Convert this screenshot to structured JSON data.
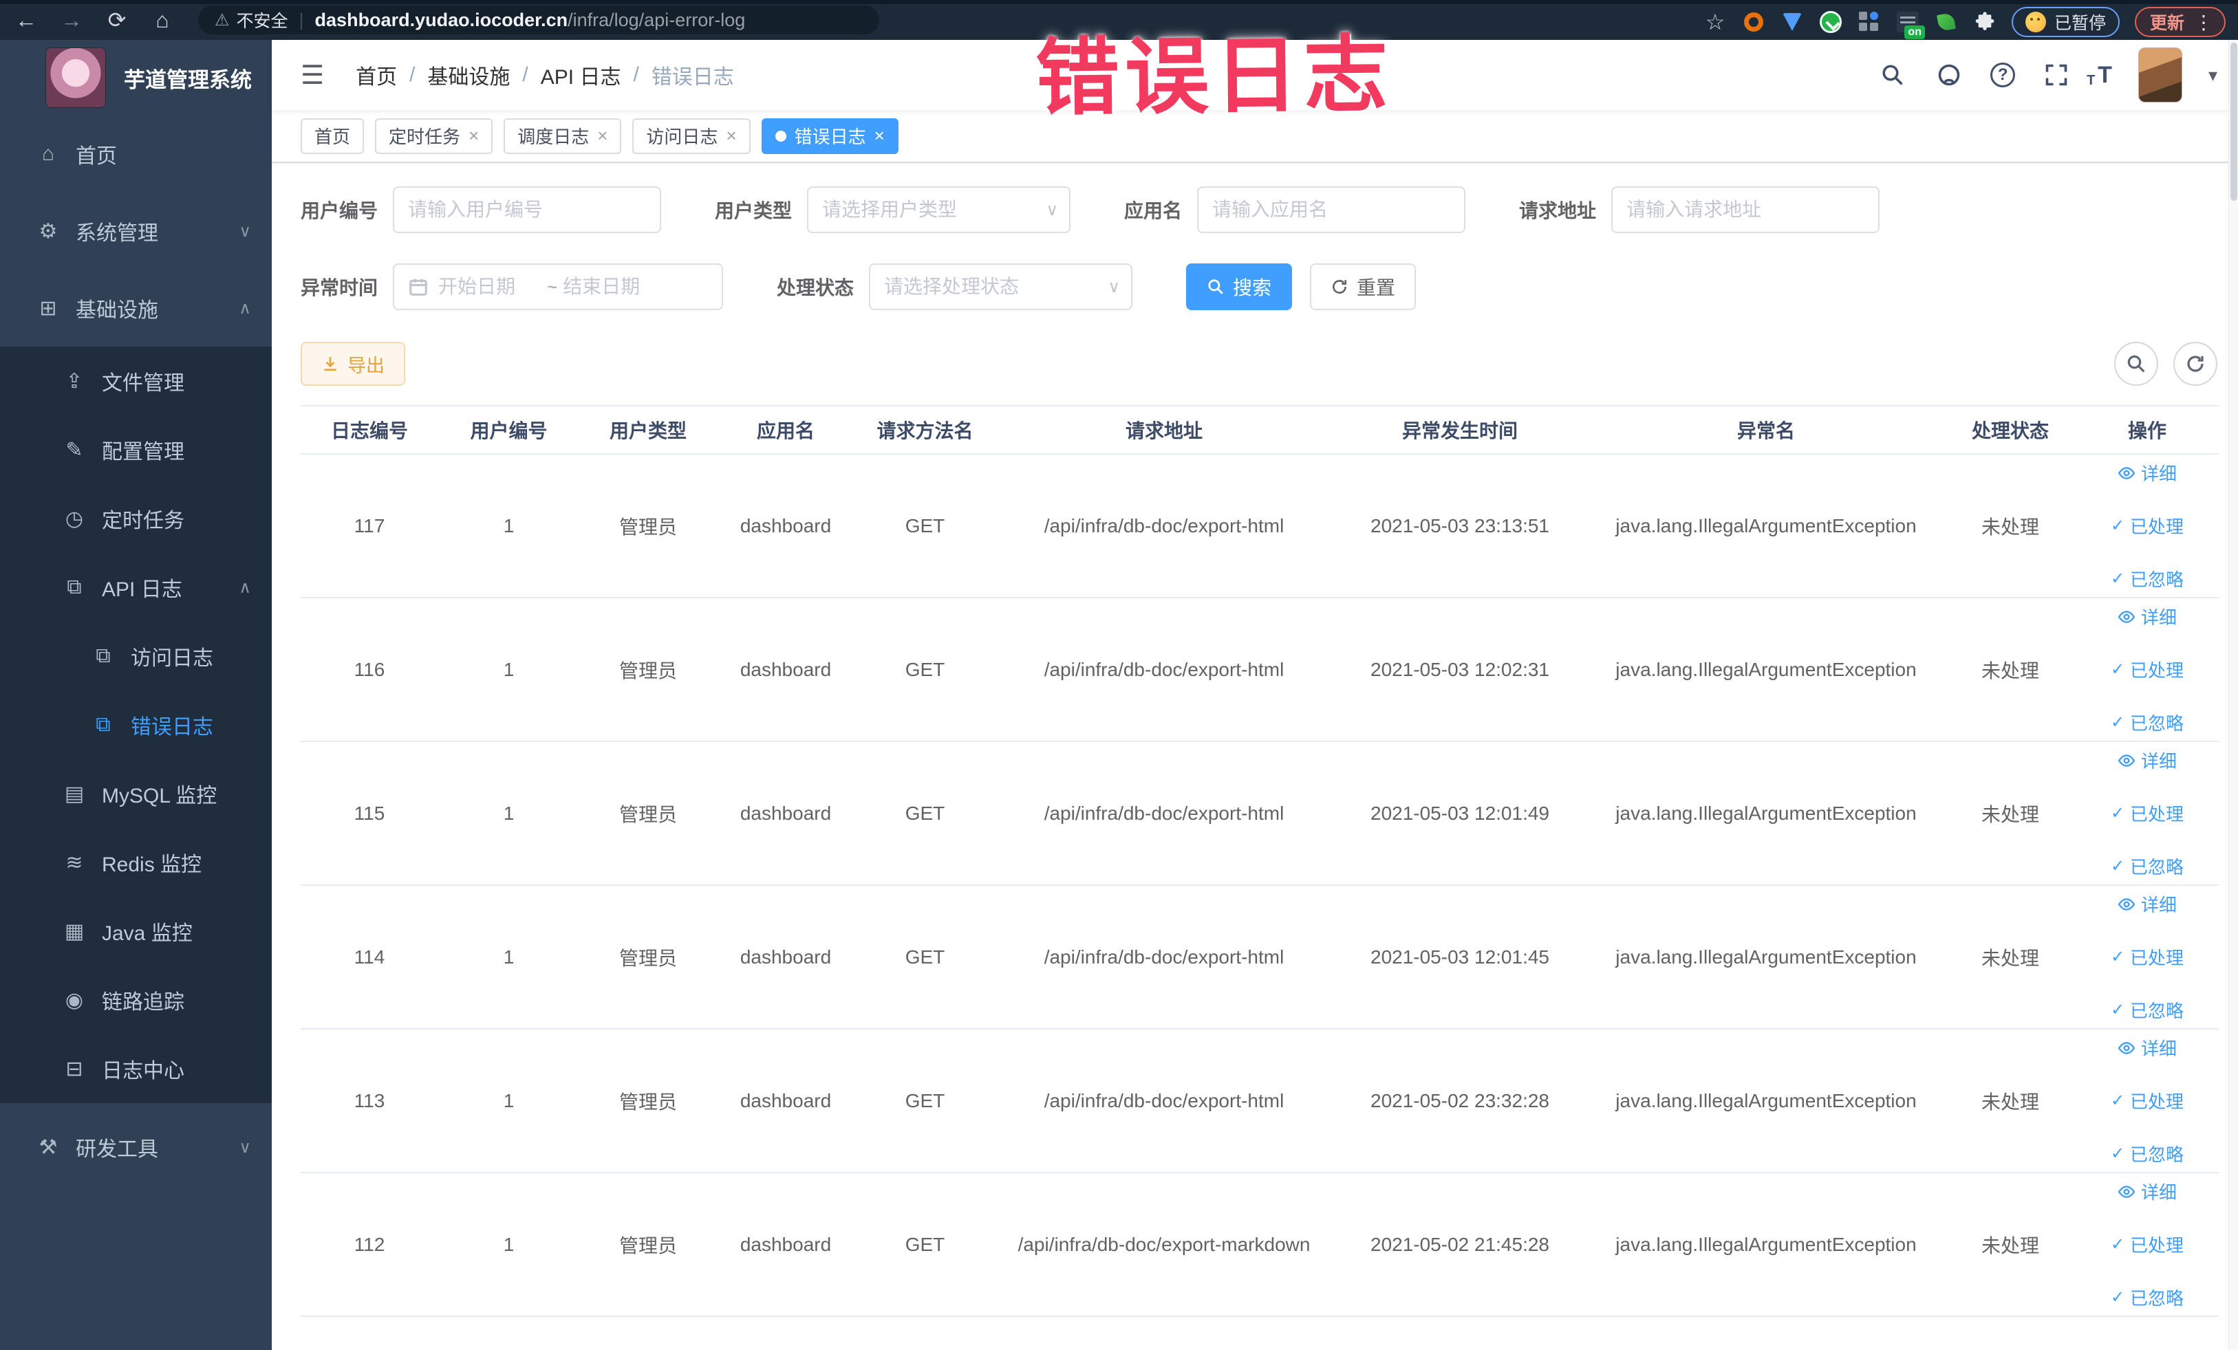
{
  "icons": {
    "back": "←",
    "forward": "→",
    "reload": "⟳",
    "home": "⌂",
    "warning": "⚠",
    "star": "☆",
    "menu_dots": "⋮",
    "hamburger": "☰",
    "caret_down": "▾",
    "chevron_down": "∨",
    "chevron_up": "∧",
    "close": "×",
    "check": "✓",
    "font_size": "T",
    "home_menu": "⌂",
    "gear": "⚙",
    "monitor": "⊞",
    "upload": "⇪",
    "edit": "✎",
    "timer": "◷",
    "doc": "⧉",
    "db": "▤",
    "redis": "≋",
    "java": "▦",
    "eye_menu": "◉",
    "logcenter": "⊟",
    "tools": "⚒"
  },
  "browser": {
    "security_label": "不安全",
    "url_domain": "dashboard.yudao.iocoder.cn",
    "url_path": "/infra/log/api-error-log",
    "on_badge": "on",
    "paused_badge": "已暂停",
    "update_button": "更新"
  },
  "overlay": {
    "annotation": "错误日志",
    "color": "#f23a5f"
  },
  "sidebar": {
    "title": "芋道管理系统",
    "items": [
      {
        "label": "首页"
      },
      {
        "label": "系统管理"
      },
      {
        "label": "基础设施"
      },
      {
        "label": "文件管理"
      },
      {
        "label": "配置管理"
      },
      {
        "label": "定时任务"
      },
      {
        "label": "API 日志"
      },
      {
        "label": "访问日志"
      },
      {
        "label": "错误日志"
      },
      {
        "label": "MySQL 监控"
      },
      {
        "label": "Redis 监控"
      },
      {
        "label": "Java 监控"
      },
      {
        "label": "链路追踪"
      },
      {
        "label": "日志中心"
      },
      {
        "label": "研发工具"
      }
    ]
  },
  "breadcrumb": {
    "separator": "/",
    "items": [
      "首页",
      "基础设施",
      "API 日志",
      "错误日志"
    ]
  },
  "tags": [
    {
      "label": "首页",
      "closable": false,
      "active": false
    },
    {
      "label": "定时任务",
      "closable": true,
      "active": false
    },
    {
      "label": "调度日志",
      "closable": true,
      "active": false
    },
    {
      "label": "访问日志",
      "closable": true,
      "active": false
    },
    {
      "label": "错误日志",
      "closable": true,
      "active": true
    }
  ],
  "filters": {
    "user_id": {
      "label": "用户编号",
      "placeholder": "请输入用户编号",
      "value": ""
    },
    "user_type": {
      "label": "用户类型",
      "placeholder": "请选择用户类型",
      "value": ""
    },
    "app_name": {
      "label": "应用名",
      "placeholder": "请输入应用名",
      "value": ""
    },
    "request_url": {
      "label": "请求地址",
      "placeholder": "请输入请求地址",
      "value": ""
    },
    "exception_time": {
      "label": "异常时间",
      "start_placeholder": "开始日期",
      "separator": "~",
      "end_placeholder": "结束日期"
    },
    "process_status": {
      "label": "处理状态",
      "placeholder": "请选择处理状态",
      "value": ""
    },
    "search_button": "搜索",
    "reset_button": "重置"
  },
  "toolbar": {
    "export_button": "导出"
  },
  "table": {
    "columns": [
      "日志编号",
      "用户编号",
      "用户类型",
      "应用名",
      "请求方法名",
      "请求地址",
      "异常发生时间",
      "异常名",
      "处理状态",
      "操作"
    ],
    "actions": [
      "详细",
      "已处理",
      "已忽略"
    ],
    "rows": [
      {
        "id": "117",
        "user_id": "1",
        "user_type": "管理员",
        "app": "dashboard",
        "method": "GET",
        "url": "/api/infra/db-doc/export-html",
        "time": "2021-05-03 23:13:51",
        "exception": "java.lang.IllegalArgumentException",
        "status": "未处理"
      },
      {
        "id": "116",
        "user_id": "1",
        "user_type": "管理员",
        "app": "dashboard",
        "method": "GET",
        "url": "/api/infra/db-doc/export-html",
        "time": "2021-05-03 12:02:31",
        "exception": "java.lang.IllegalArgumentException",
        "status": "未处理"
      },
      {
        "id": "115",
        "user_id": "1",
        "user_type": "管理员",
        "app": "dashboard",
        "method": "GET",
        "url": "/api/infra/db-doc/export-html",
        "time": "2021-05-03 12:01:49",
        "exception": "java.lang.IllegalArgumentException",
        "status": "未处理"
      },
      {
        "id": "114",
        "user_id": "1",
        "user_type": "管理员",
        "app": "dashboard",
        "method": "GET",
        "url": "/api/infra/db-doc/export-html",
        "time": "2021-05-03 12:01:45",
        "exception": "java.lang.IllegalArgumentException",
        "status": "未处理"
      },
      {
        "id": "113",
        "user_id": "1",
        "user_type": "管理员",
        "app": "dashboard",
        "method": "GET",
        "url": "/api/infra/db-doc/export-html",
        "time": "2021-05-02 23:32:28",
        "exception": "java.lang.IllegalArgumentException",
        "status": "未处理"
      },
      {
        "id": "112",
        "user_id": "1",
        "user_type": "管理员",
        "app": "dashboard",
        "method": "GET",
        "url": "/api/infra/db-doc/export-markdown",
        "time": "2021-05-02 21:45:28",
        "exception": "java.lang.IllegalArgumentException",
        "status": "未处理"
      }
    ]
  }
}
